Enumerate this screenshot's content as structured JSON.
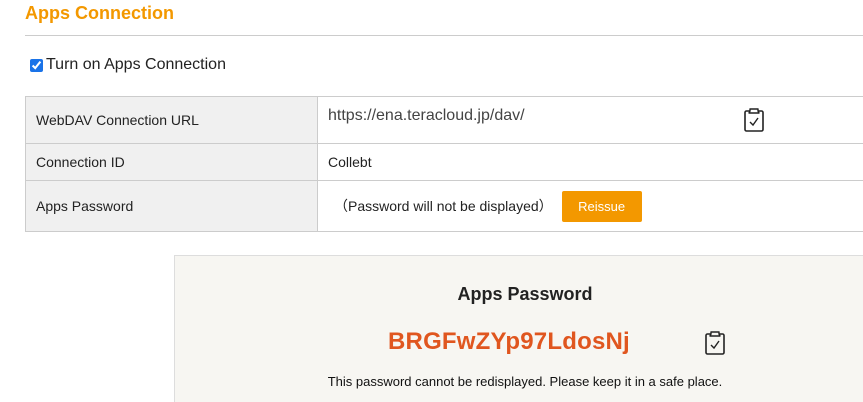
{
  "section": {
    "title": "Apps Connection"
  },
  "toggle": {
    "label": "Turn on Apps Connection",
    "checked": true
  },
  "settings_rows": [
    {
      "label": "WebDAV Connection URL",
      "value": "https://ena.teracloud.jp/dav/",
      "copy_icon": "clipboard-check-icon"
    },
    {
      "label": "Connection ID",
      "value": "Collebt"
    },
    {
      "label": "Apps Password",
      "value": "（Password will not be displayed）",
      "button_label": "Reissue"
    }
  ],
  "password_panel": {
    "title": "Apps Password",
    "password": "BRGFwZYp97LdosNj",
    "copy_icon": "clipboard-check-icon",
    "warning": "This password cannot be redisplayed. Please keep it in a safe place."
  },
  "colors": {
    "accent": "#f39800",
    "password_text": "#e0561f",
    "label_bg": "#f0f0f0",
    "panel_bg": "#f7f6f2"
  }
}
